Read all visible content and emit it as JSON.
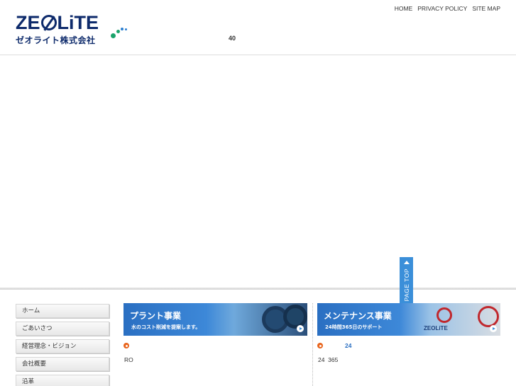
{
  "header": {
    "logo_en_1": "ZE",
    "logo_en_2": "LiTE",
    "logo_jp": "ゼオライト株式会社",
    "tagline": "40",
    "nav": [
      "HOME",
      "PRIVACY POLICY",
      "SITE MAP"
    ]
  },
  "page_top": {
    "label": "PAGE TOP"
  },
  "sidenav": {
    "items": [
      "ホーム",
      "ごあいさつ",
      "経営理念・ビジョン",
      "会社概要",
      "沿革"
    ]
  },
  "banners": {
    "plant": {
      "title": "プラント事業",
      "subtitle": "水のコスト削減を提案します。"
    },
    "maintenance": {
      "title": "メンテナンス事業",
      "subtitle": "24時間365日のサポート",
      "logo": "ZEOLiTE"
    }
  },
  "sections": {
    "plant_text": "RO",
    "maint_highlight": "24",
    "maint_text": "24  365"
  },
  "colors": {
    "brand": "#0d2a6b",
    "accent": "#3b8fd9",
    "bullet": "#e8641c"
  }
}
